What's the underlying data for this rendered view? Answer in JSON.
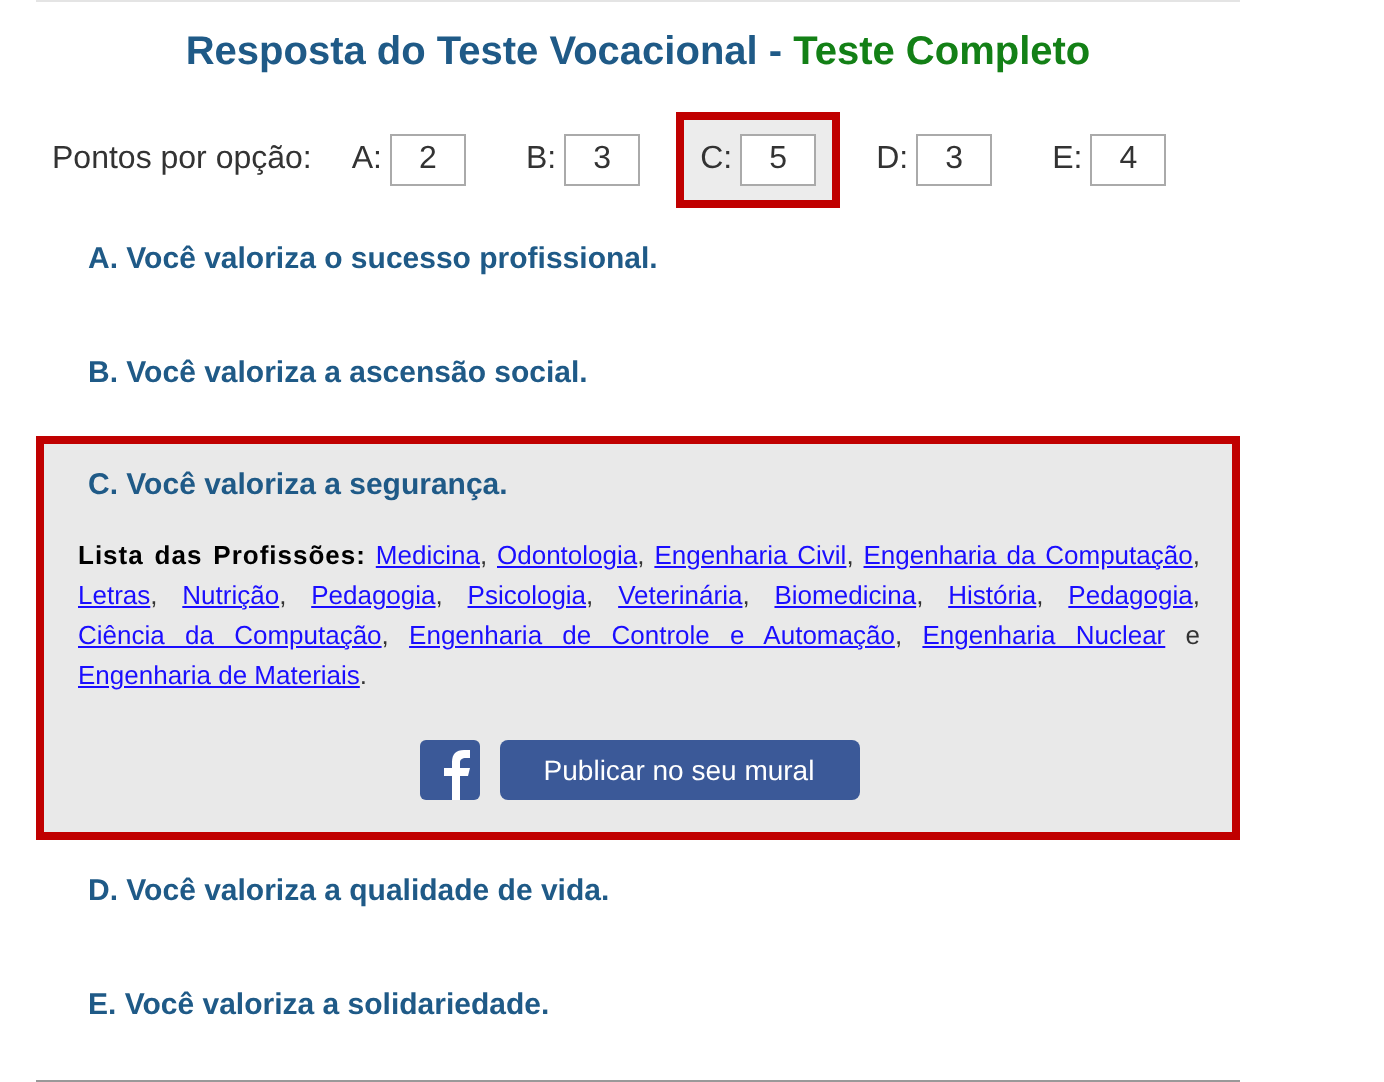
{
  "title": {
    "main": "Resposta do Teste Vocacional -",
    "highlight": "Teste Completo"
  },
  "scores": {
    "label": "Pontos por opção:",
    "options": [
      {
        "letter": "A:",
        "value": "2",
        "selected": false
      },
      {
        "letter": "B:",
        "value": "3",
        "selected": false
      },
      {
        "letter": "C:",
        "value": "5",
        "selected": true
      },
      {
        "letter": "D:",
        "value": "3",
        "selected": false
      },
      {
        "letter": "E:",
        "value": "4",
        "selected": false
      }
    ]
  },
  "answers": [
    {
      "text": "A. Você valoriza o sucesso profissional.",
      "selected": false
    },
    {
      "text": "B. Você valoriza a ascensão social.",
      "selected": false
    },
    {
      "text": "C. Você valoriza a segurança.",
      "selected": true
    },
    {
      "text": "D. Você valoriza a qualidade de vida.",
      "selected": false
    },
    {
      "text": "E. Você valoriza a solidariedade.",
      "selected": false
    }
  ],
  "professions": {
    "label": "Lista das Profissões:",
    "separator": ",",
    "last_joiner": "e",
    "end": ".",
    "items": [
      "Medicina",
      "Odontologia",
      "Engenharia Civil",
      "Engenharia da Computação",
      "Letras",
      "Nutrição",
      "Pedagogia",
      "Psicologia",
      "Veterinária",
      "Biomedicina",
      "História",
      "Pedagogia",
      "Ciência da Computação",
      "Engenharia de Controle e Automação",
      "Engenharia Nuclear",
      "Engenharia de Materiais"
    ]
  },
  "share_button": "Publicar no seu mural"
}
